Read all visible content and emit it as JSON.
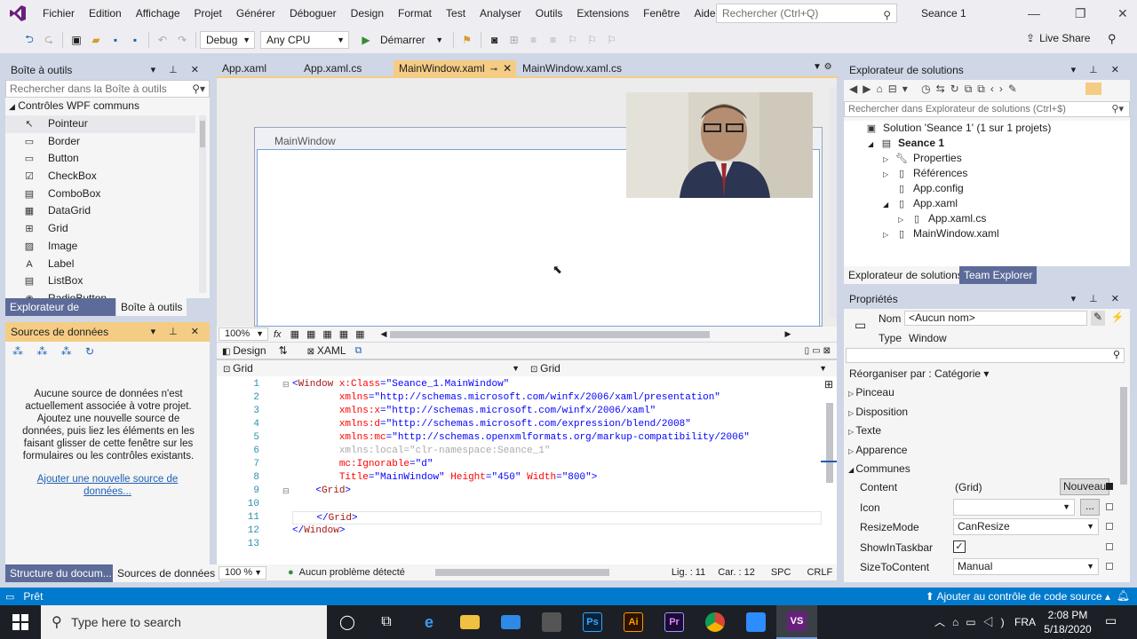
{
  "menubar": {
    "items": [
      "Fichier",
      "Edition",
      "Affichage",
      "Projet",
      "Générer",
      "Déboguer",
      "Design",
      "Format",
      "Test",
      "Analyser",
      "Outils",
      "Extensions",
      "Fenêtre",
      "Aide"
    ],
    "search_placeholder": "Rechercher (Ctrl+Q)",
    "solution_name": "Seance 1",
    "minimize": "—",
    "restore": "❐",
    "close": "✕"
  },
  "toolbar": {
    "config": "Debug",
    "platform": "Any CPU",
    "start_label": "Démarrer",
    "live_share": "Live Share"
  },
  "toolbox": {
    "title": "Boîte à outils",
    "search_placeholder": "Rechercher dans la Boîte à outils",
    "group": "Contrôles WPF communs",
    "items": [
      "Pointeur",
      "Border",
      "Button",
      "CheckBox",
      "ComboBox",
      "DataGrid",
      "Grid",
      "Image",
      "Label",
      "ListBox",
      "RadioButton"
    ],
    "tabs": [
      "Explorateur de serveurs",
      "Boîte à outils"
    ]
  },
  "datasources": {
    "title": "Sources de données",
    "message": "Aucune source de données n'est actuellement associée à votre projet. Ajoutez une nouvelle source de données, puis liez les éléments en les faisant glisser de cette fenêtre sur les formulaires ou les contrôles existants.",
    "link": "Ajouter une nouvelle source de données...",
    "tabs": [
      "Structure du docum...",
      "Sources de données"
    ]
  },
  "doc_tabs": [
    "App.xaml",
    "App.xaml.cs",
    "MainWindow.xaml",
    "MainWindow.xaml.cs"
  ],
  "designer": {
    "window_title": "MainWindow",
    "zoom": "100%",
    "fx": "fx"
  },
  "split": {
    "design_tab": "Design",
    "swap": "⇅",
    "xaml_tab": "XAML",
    "left_scope": "Grid",
    "right_scope": "Grid"
  },
  "code": {
    "line_numbers": [
      "1",
      "2",
      "3",
      "4",
      "5",
      "6",
      "7",
      "8",
      "9",
      "10",
      "11",
      "12",
      "13"
    ],
    "zoom": "100 %",
    "status": "Aucun problème détecté",
    "line": "Lig. : 11",
    "col": "Car. : 12",
    "spc": "SPC",
    "crlf": "CRLF"
  },
  "solution_explorer": {
    "title": "Explorateur de solutions",
    "search_placeholder": "Rechercher dans Explorateur de solutions (Ctrl+$)",
    "items": [
      {
        "label": "Solution 'Seance 1' (1 sur 1 projets)",
        "indent": 0,
        "arrow": ""
      },
      {
        "label": "Seance 1",
        "indent": 1,
        "arrow": "◢",
        "bold": true
      },
      {
        "label": "Properties",
        "indent": 2,
        "arrow": "▷"
      },
      {
        "label": "Références",
        "indent": 2,
        "arrow": "▷"
      },
      {
        "label": "App.config",
        "indent": 2,
        "arrow": ""
      },
      {
        "label": "App.xaml",
        "indent": 2,
        "arrow": "◢"
      },
      {
        "label": "App.xaml.cs",
        "indent": 3,
        "arrow": "▷"
      },
      {
        "label": "MainWindow.xaml",
        "indent": 2,
        "arrow": "▷"
      }
    ],
    "tabs": [
      "Explorateur de solutions",
      "Team Explorer"
    ]
  },
  "properties": {
    "title": "Propriétés",
    "name_label": "Nom",
    "name_value": "<Aucun nom>",
    "type_label": "Type",
    "type_value": "Window",
    "sort_label": "Réorganiser par : Catégorie ▾",
    "categories": [
      "Pinceau",
      "Disposition",
      "Texte",
      "Apparence",
      "Communes"
    ],
    "rows": [
      {
        "name": "Content",
        "value": "(Grid)",
        "button": "Nouveau"
      },
      {
        "name": "Icon",
        "value": ""
      },
      {
        "name": "ResizeMode",
        "value": "CanResize"
      },
      {
        "name": "ShowInTaskbar",
        "value": "✓"
      },
      {
        "name": "SizeToContent",
        "value": "Manual"
      }
    ]
  },
  "statusbar": {
    "ready": "Prêt",
    "source_control": "Ajouter au contrôle de code source ▴"
  },
  "taskbar": {
    "search_placeholder": "Type here to search",
    "time": "2:08 PM",
    "date": "5/18/2020",
    "lang": "FRA"
  }
}
